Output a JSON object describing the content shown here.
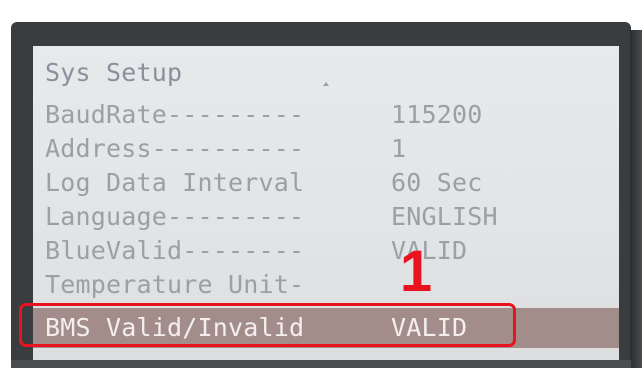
{
  "screen": {
    "title": "Sys Setup",
    "rows": [
      {
        "label": "BaudRate---------",
        "value": "115200"
      },
      {
        "label": "Address----------",
        "value": "1"
      },
      {
        "label": "Log Data Interval",
        "value": "60 Sec"
      },
      {
        "label": "Language---------",
        "value": "ENGLISH"
      },
      {
        "label": "BlueValid--------",
        "value": "VALID"
      },
      {
        "label": "Temperature Unit-",
        "value": ""
      },
      {
        "label": "BMS Valid/Invalid",
        "value": "VALID"
      }
    ],
    "selected_row_index": 6
  },
  "annotation": {
    "callout_number": "1",
    "callout_color": "#e8131f"
  },
  "colors": {
    "lcd_background": "#e4e6e8",
    "text_dim": "#9aa0a6",
    "selected_row_bg": "#a28d8a",
    "selected_row_text": "#f4efee"
  }
}
